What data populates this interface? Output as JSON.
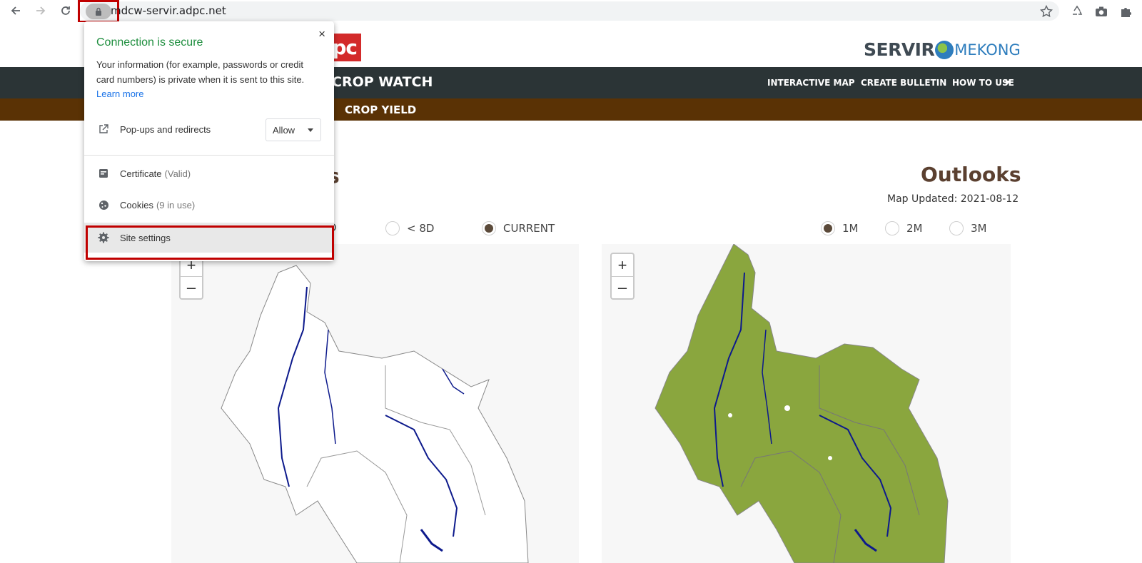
{
  "browser": {
    "url": "mdcw-servir.adpc.net"
  },
  "site": {
    "adpc_logo_text": "pc",
    "servir_logo": "SERVIR",
    "mekong_logo": "MEKONG",
    "title": "CROP WATCH",
    "nav": [
      "INTERACTIVE MAP",
      "CREATE BULLETIN",
      "HOW TO USE"
    ],
    "sub_title": "CROP YIELD"
  },
  "left_panel": {
    "heading_partial": "s",
    "radios": [
      {
        "label": "D",
        "selected": false
      },
      {
        "label": "< 8D",
        "selected": false
      },
      {
        "label": "CURRENT",
        "selected": true
      }
    ]
  },
  "right_panel": {
    "heading": "Outlooks",
    "updated": "Map Updated: 2021-08-12",
    "radios": [
      {
        "label": "1M",
        "selected": true
      },
      {
        "label": "2M",
        "selected": false
      },
      {
        "label": "3M",
        "selected": false
      }
    ]
  },
  "map": {
    "zoom_in": "+",
    "zoom_out": "–",
    "colors": {
      "land": "#8aa63e",
      "water": "#0d1a8c",
      "border": "#888888"
    }
  },
  "popup": {
    "title": "Connection is secure",
    "description": "Your information (for example, passwords or credit card numbers) is private when it is sent to this site.",
    "learn_more": "Learn more",
    "popups_label": "Pop-ups and redirects",
    "popups_value": "Allow",
    "certificate": "Certificate",
    "certificate_status": "(Valid)",
    "cookies": "Cookies",
    "cookies_status": "(9 in use)",
    "site_settings": "Site settings",
    "close": "×"
  },
  "colors": {
    "nav_bg": "#2b3436",
    "subnav_bg": "#5a3205",
    "accent_green": "#1e8e3e",
    "highlight": "#c00000"
  }
}
